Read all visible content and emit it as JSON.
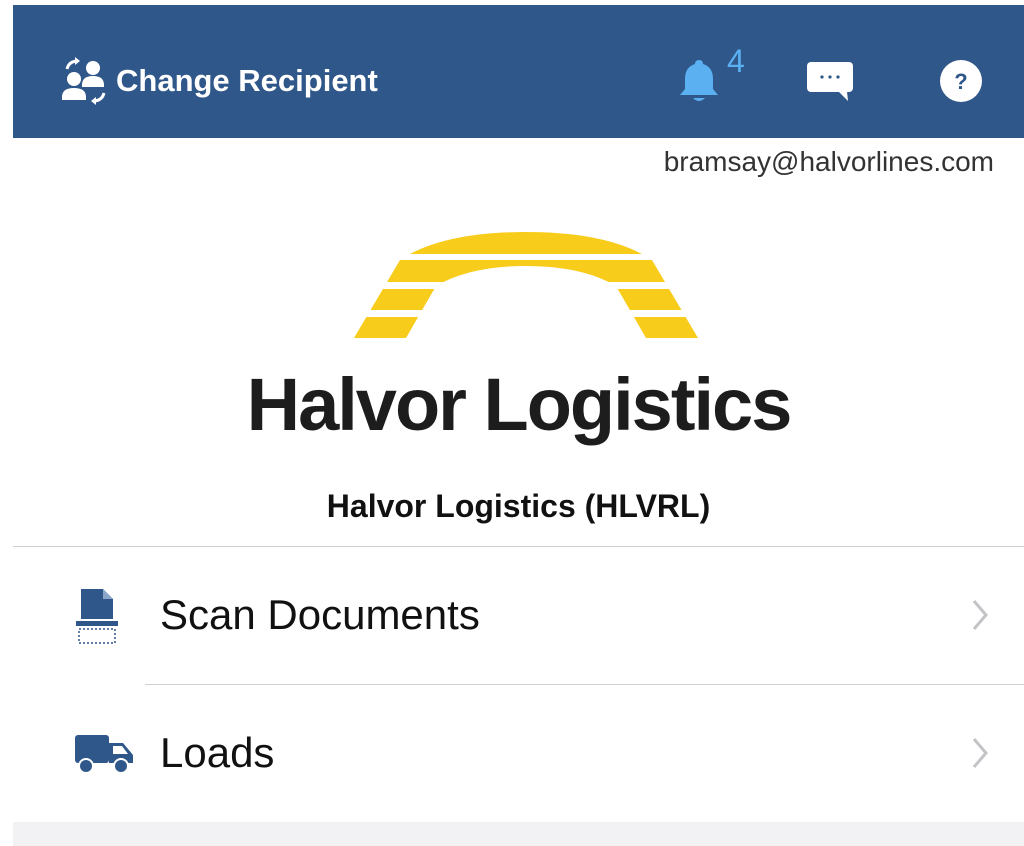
{
  "header": {
    "change_recipient_label": "Change Recipient",
    "notification_count": "4",
    "background_color": "#2f5789",
    "bell_color": "#5ab0f0",
    "icons": [
      "change-recipient-icon",
      "bell-icon",
      "message-icon",
      "help-icon"
    ]
  },
  "user": {
    "email": "bramsay@halvorlines.com"
  },
  "company": {
    "logo_text": "Halvor Logistics",
    "logo_color": "#f8cc1b",
    "display_name": "Halvor Logistics (HLVRL)"
  },
  "menu": {
    "items": [
      {
        "label": "Scan Documents",
        "icon": "scan-document-icon"
      },
      {
        "label": "Loads",
        "icon": "truck-icon"
      }
    ],
    "icon_color": "#2f5789"
  }
}
